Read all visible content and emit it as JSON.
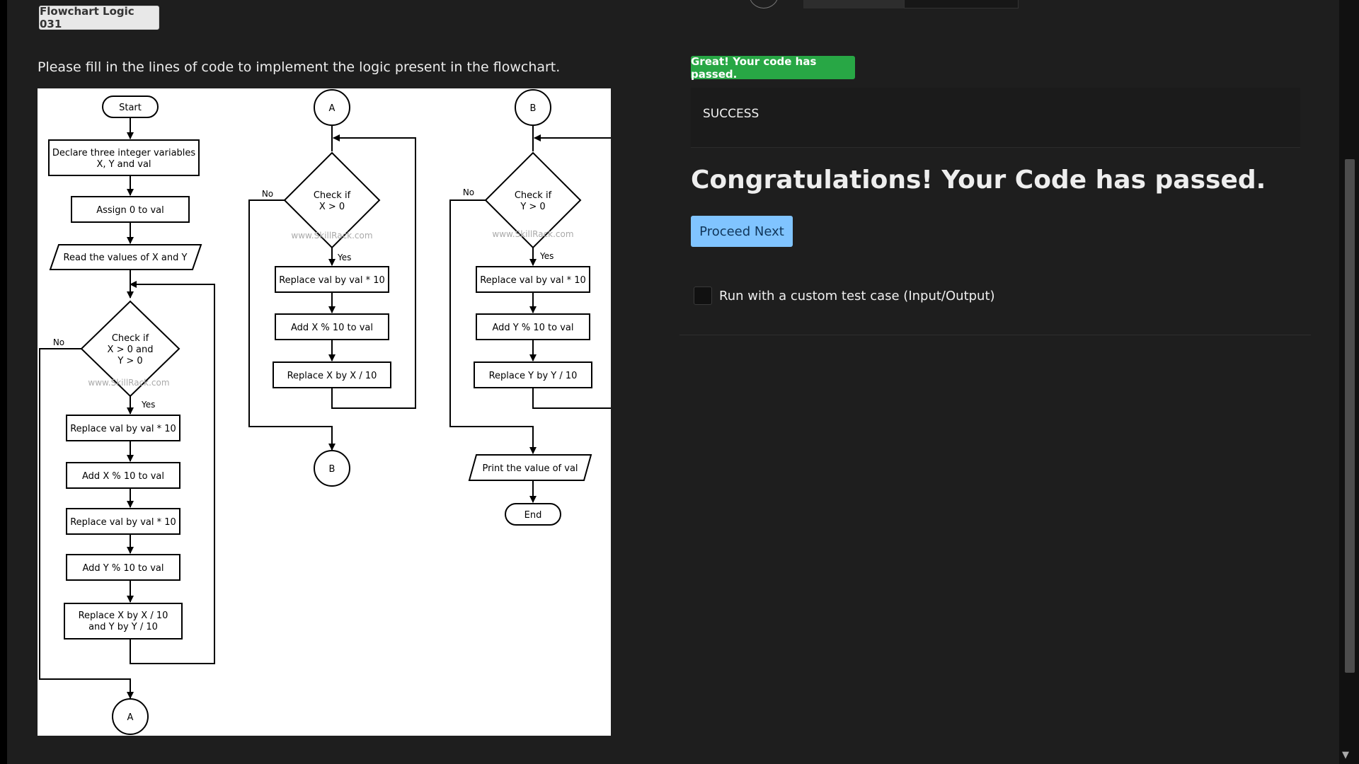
{
  "header": {
    "problem_tag": "Flowchart Logic 031"
  },
  "problem": {
    "instructions": "Please fill in the lines of code to implement the logic present in the flowchart."
  },
  "flowchart": {
    "watermark": "www.SkillRack.com",
    "col1": {
      "start": "Start",
      "declare_line1": "Declare three integer variables",
      "declare_line2": "X, Y and val",
      "assign": "Assign 0 to val",
      "read": "Read the values of X and Y",
      "check_line1": "Check if",
      "check_line2": "X > 0 and",
      "check_line3": "Y > 0",
      "no": "No",
      "yes": "Yes",
      "step1": "Replace val by val * 10",
      "step2": "Add X % 10 to val",
      "step3": "Replace val by val * 10",
      "step4": "Add Y % 10 to val",
      "step5_line1": "Replace X by X / 10",
      "step5_line2": "and Y by Y / 10",
      "connector": "A"
    },
    "col2": {
      "connector_in": "A",
      "check_line1": "Check if",
      "check_line2": "X > 0",
      "no": "No",
      "yes": "Yes",
      "step1": "Replace val by val * 10",
      "step2": "Add X % 10 to val",
      "step3": "Replace X by X / 10",
      "connector_out": "B"
    },
    "col3": {
      "connector_in": "B",
      "check_line1": "Check if",
      "check_line2": "Y > 0",
      "no": "No",
      "yes": "Yes",
      "step1": "Replace val by val * 10",
      "step2": "Add Y % 10 to val",
      "step3": "Replace Y by Y / 10",
      "print": "Print the value of val",
      "end": "End"
    }
  },
  "result": {
    "badge": "Great! Your code has passed.",
    "status": "SUCCESS",
    "message": "Congratulations! Your Code has passed.",
    "proceed_label": "Proceed Next",
    "custom_test_label": "Run with a custom test case (Input/Output)"
  },
  "colors": {
    "success_green": "#28a745",
    "proceed_blue": "#80c4ff",
    "page_bg": "#1e1e1e"
  }
}
